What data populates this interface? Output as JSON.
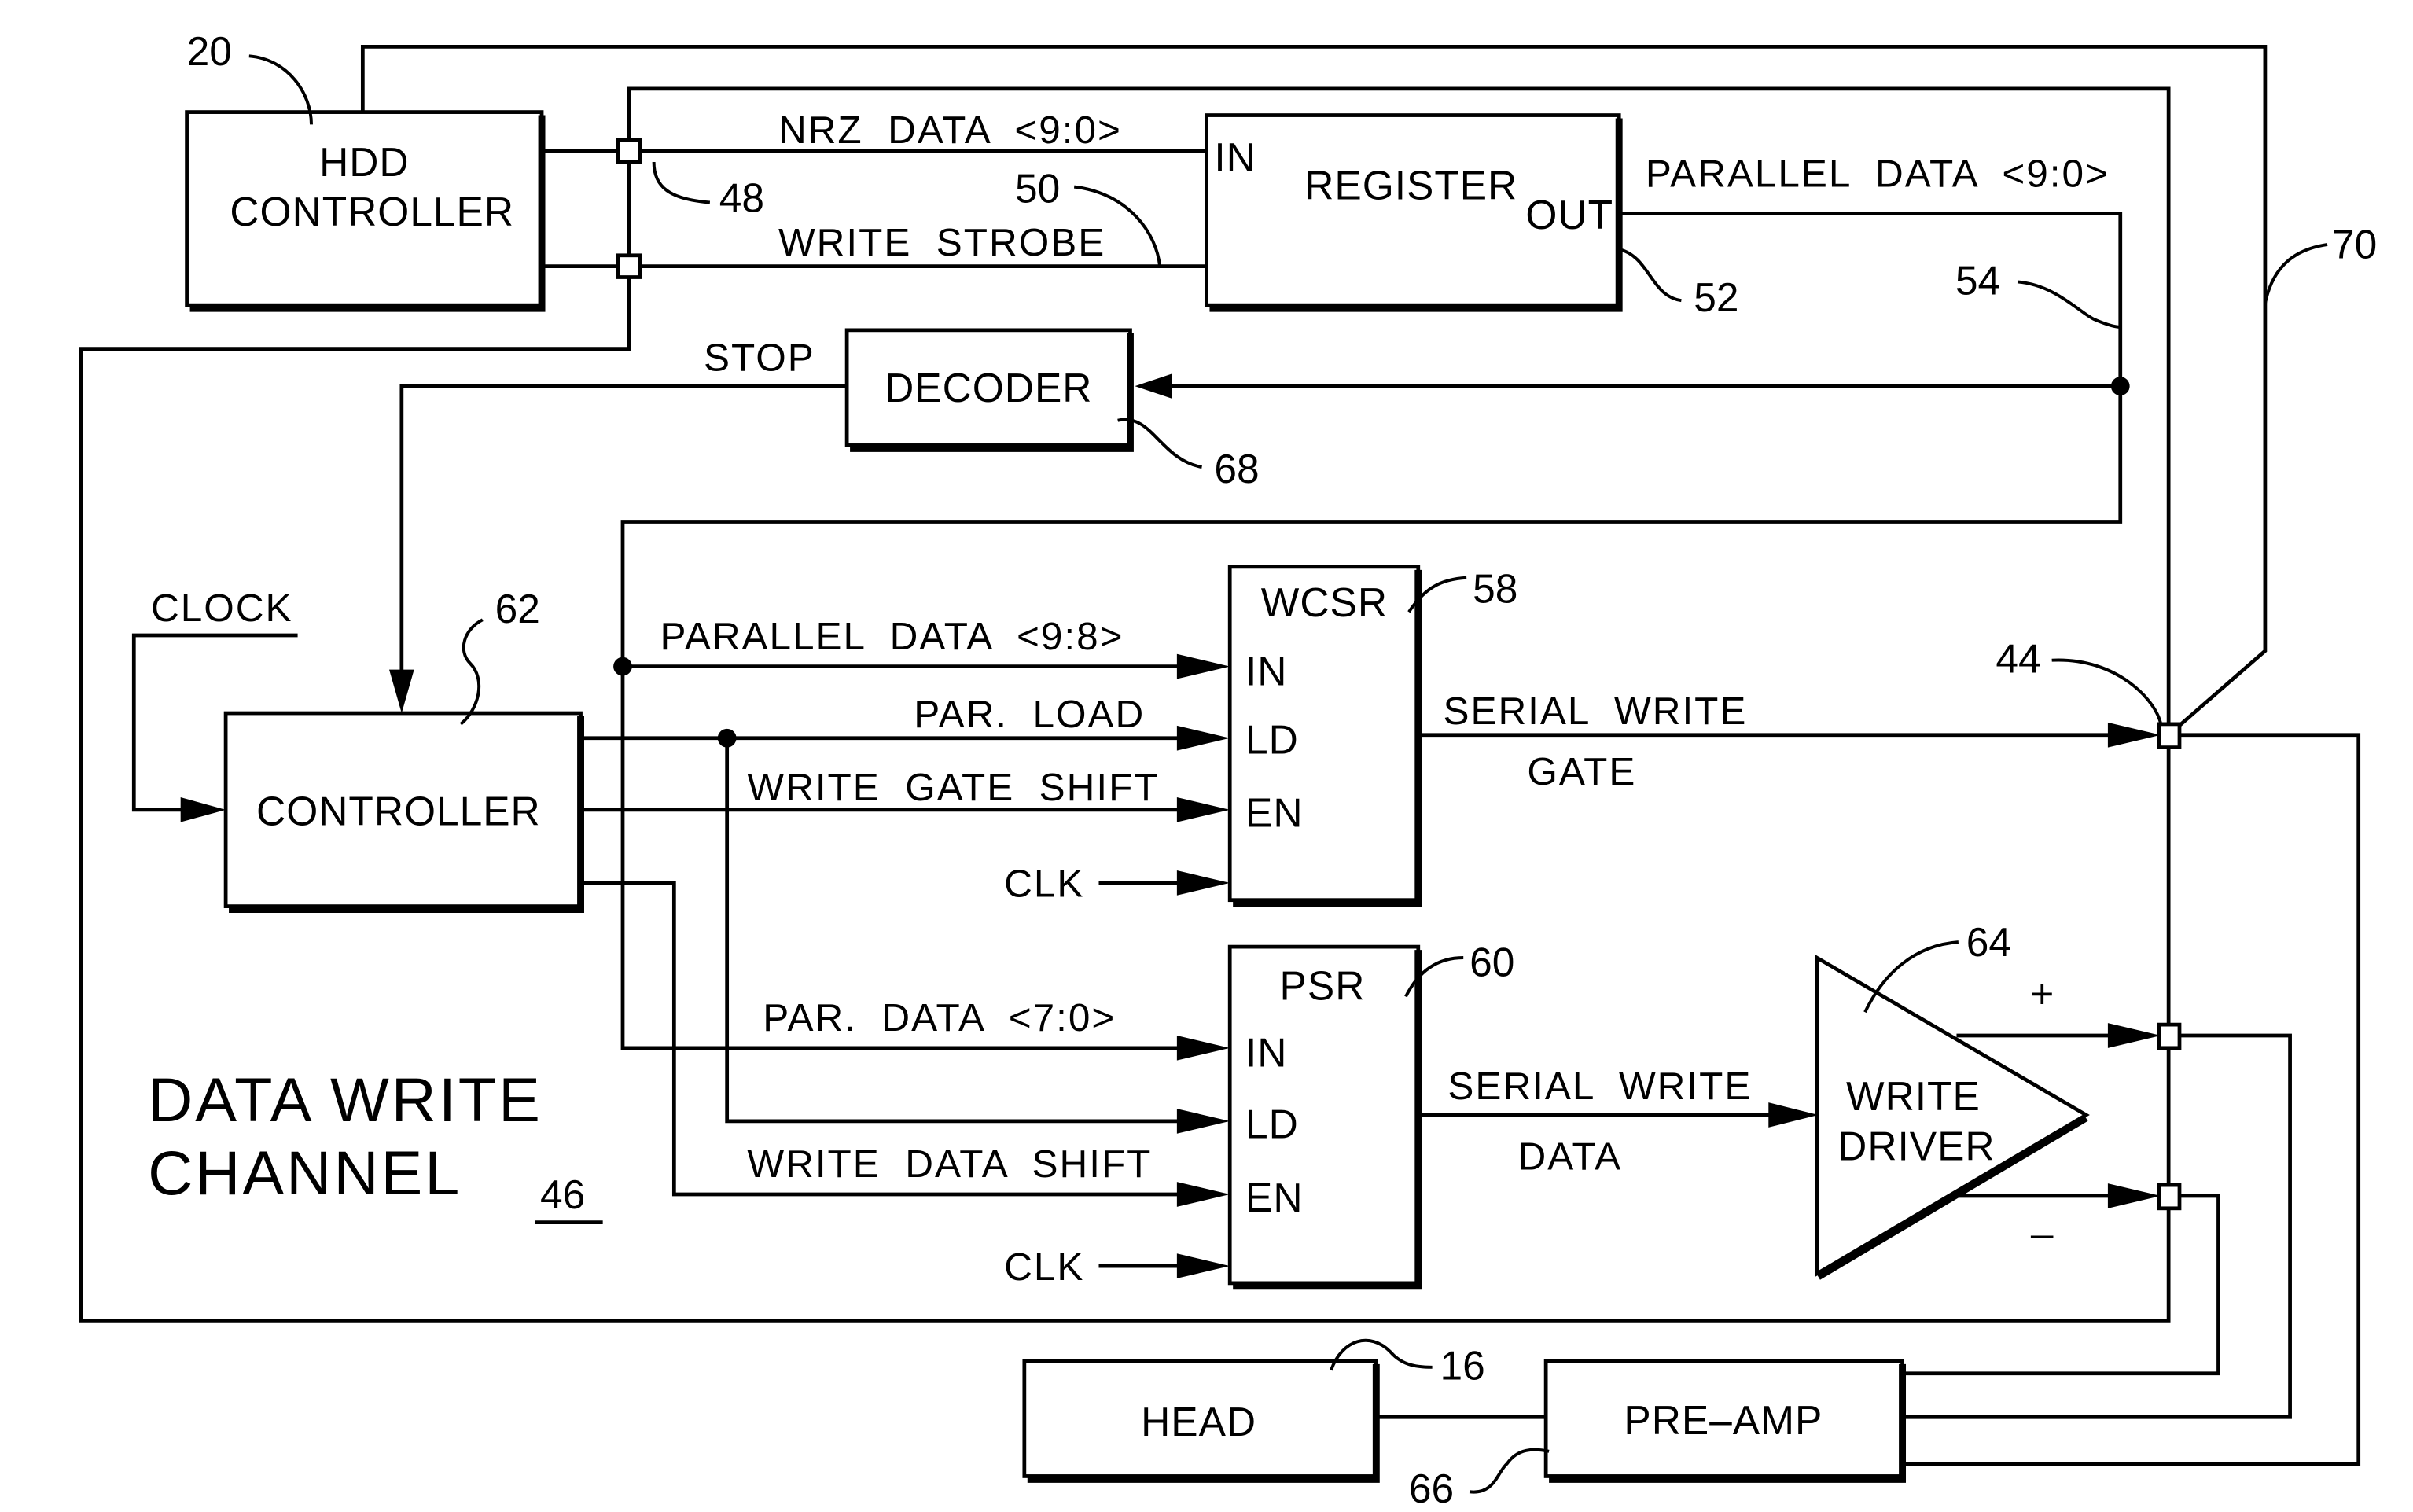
{
  "figure": {
    "title": "DATA WRITE CHANNEL",
    "title_line1": "DATA WRITE",
    "title_line2": "CHANNEL",
    "title_ref": "46"
  },
  "blocks": {
    "hdd_controller": {
      "line1": "HDD",
      "line2": "CONTROLLER",
      "ref": "20"
    },
    "register": {
      "label": "REGISTER",
      "in": "IN",
      "out": "OUT",
      "ref": "52"
    },
    "decoder": {
      "label": "DECODER",
      "ref": "68"
    },
    "controller": {
      "label": "CONTROLLER",
      "ref": "62"
    },
    "wcsr": {
      "label": "WCSR",
      "ref": "58",
      "ports": [
        "IN",
        "LD",
        "EN"
      ]
    },
    "psr": {
      "label": "PSR",
      "ref": "60",
      "ports": [
        "IN",
        "LD",
        "EN"
      ]
    },
    "write_driver": {
      "line1": "WRITE",
      "line2": "DRIVER",
      "ref": "64",
      "plus": "+",
      "minus": "–"
    },
    "head": {
      "label": "HEAD",
      "ref": "16"
    },
    "pre_amp": {
      "label": "PRE–AMP",
      "ref": "66"
    }
  },
  "signals": {
    "nrz_data": "NRZ  DATA  <9:0>",
    "write_strobe": "WRITE  STROBE",
    "parallel_data_9_0": "PARALLEL  DATA  <9:0>",
    "stop": "STOP",
    "clock": "CLOCK",
    "parallel_data_9_8": "PARALLEL  DATA  <9:8>",
    "par_load": "PAR.  LOAD",
    "write_gate_shift": "WRITE  GATE  SHIFT",
    "clk": "CLK",
    "serial_write_gate_1": "SERIAL  WRITE",
    "serial_write_gate_2": "GATE",
    "par_data_7_0": "PAR.  DATA  <7:0>",
    "write_data_shift": "WRITE  DATA  SHIFT",
    "serial_write_data_1": "SERIAL  WRITE",
    "serial_write_data_2": "DATA"
  },
  "refs": {
    "connector_48": "48",
    "write_strobe_50": "50",
    "parallel_bus_54": "54",
    "connector_44": "44",
    "bus_70": "70"
  }
}
